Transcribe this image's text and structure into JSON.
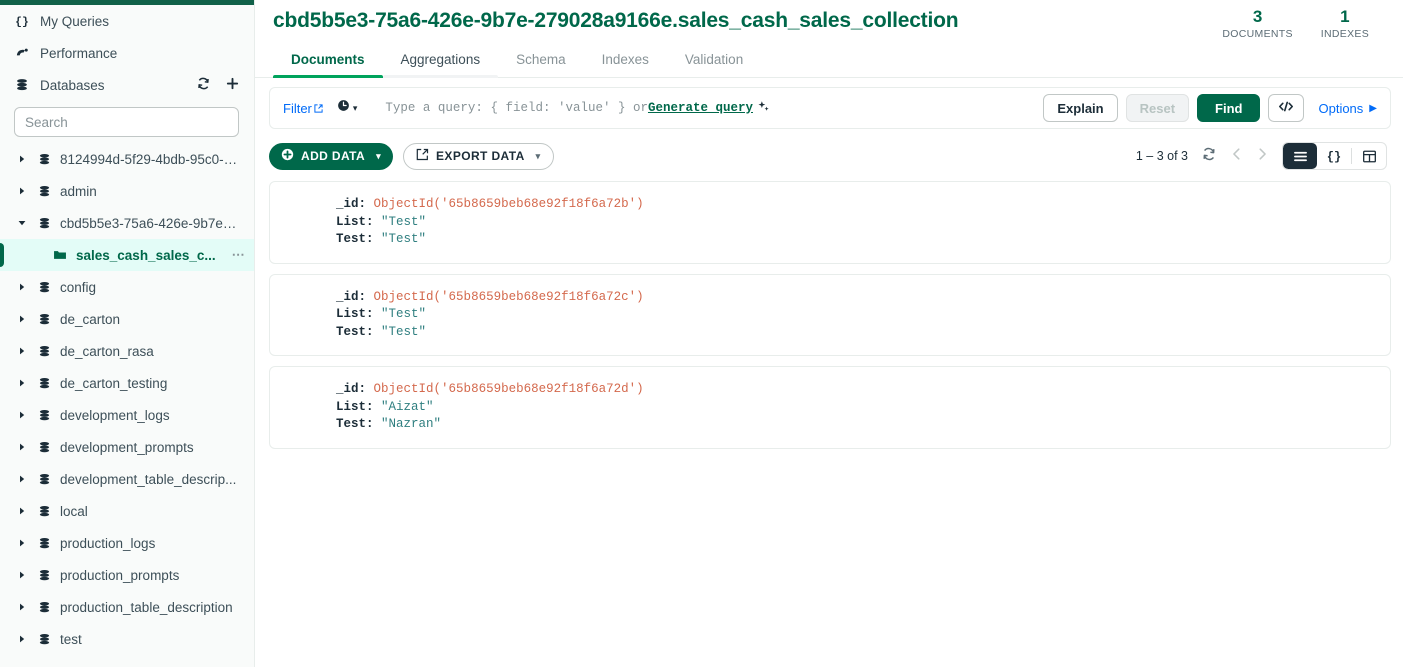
{
  "theme": {
    "brand_green": "#00684a",
    "dark_green_bar": "#116149",
    "accent_blue": "#016bf8",
    "selected_bg": "#e3fcf7",
    "string_value_color": "#307f80",
    "objectid_color": "#d4694d"
  },
  "sidebar": {
    "nav": [
      {
        "label": "My Queries",
        "icon": "braces-icon"
      },
      {
        "label": "Performance",
        "icon": "performance-icon"
      },
      {
        "label": "Databases",
        "icon": "database-icon"
      }
    ],
    "db_actions": [
      {
        "name": "refresh-databases-button",
        "icon": "refresh-icon"
      },
      {
        "name": "create-database-button",
        "icon": "plus-icon"
      }
    ],
    "search": {
      "placeholder": "Search",
      "value": ""
    },
    "tree": [
      {
        "label": "8124994d-5f29-4bdb-95c0-9...",
        "type": "database",
        "expanded": false
      },
      {
        "label": "admin",
        "type": "database",
        "expanded": false
      },
      {
        "label": "cbd5b5e3-75a6-426e-9b7e-...",
        "type": "database",
        "expanded": true
      },
      {
        "label": "sales_cash_sales_c...",
        "type": "collection",
        "selected": true,
        "menu": "⋯"
      },
      {
        "label": "config",
        "type": "database",
        "expanded": false
      },
      {
        "label": "de_carton",
        "type": "database",
        "expanded": false
      },
      {
        "label": "de_carton_rasa",
        "type": "database",
        "expanded": false
      },
      {
        "label": "de_carton_testing",
        "type": "database",
        "expanded": false
      },
      {
        "label": "development_logs",
        "type": "database",
        "expanded": false
      },
      {
        "label": "development_prompts",
        "type": "database",
        "expanded": false
      },
      {
        "label": "development_table_descrip...",
        "type": "database",
        "expanded": false
      },
      {
        "label": "local",
        "type": "database",
        "expanded": false
      },
      {
        "label": "production_logs",
        "type": "database",
        "expanded": false
      },
      {
        "label": "production_prompts",
        "type": "database",
        "expanded": false
      },
      {
        "label": "production_table_description",
        "type": "database",
        "expanded": false
      },
      {
        "label": "test",
        "type": "database",
        "expanded": false
      }
    ]
  },
  "header": {
    "title": "cbd5b5e3-75a6-426e-9b7e-279028a9166e.sales_cash_sales_collection",
    "stats": [
      {
        "value": "3",
        "label": "DOCUMENTS"
      },
      {
        "value": "1",
        "label": "INDEXES"
      }
    ]
  },
  "tabs": [
    {
      "label": "Documents",
      "state": "active"
    },
    {
      "label": "Aggregations",
      "state": "hovered"
    },
    {
      "label": "Schema",
      "state": "normal"
    },
    {
      "label": "Indexes",
      "state": "normal"
    },
    {
      "label": "Validation",
      "state": "normal"
    }
  ],
  "querybar": {
    "filter_label": "Filter",
    "filter_icon": "external-link-icon",
    "history_icon": "clock-icon",
    "history_caret": "▾",
    "placeholder_prefix": "Type a query: { field: 'value' } or ",
    "generate_query_label": "Generate query",
    "sparkle_icon": "sparkle-icon",
    "buttons": {
      "explain": "Explain",
      "reset": "Reset",
      "find": "Find",
      "export_to_language_icon": "code-brackets-icon",
      "options": "Options",
      "options_caret": "▶"
    }
  },
  "toolbar": {
    "add_data": "ADD DATA",
    "add_data_icon": "plus-circle-icon",
    "add_data_caret": "▾",
    "export_data": "EXPORT DATA",
    "export_data_icon": "export-icon",
    "export_data_caret": "▾",
    "count": "1 – 3 of 3",
    "refresh_icon": "refresh-icon",
    "prev_icon": "chevron-left-icon",
    "next_icon": "chevron-right-icon",
    "views": [
      {
        "name": "list-view",
        "icon": "list-icon",
        "selected": true
      },
      {
        "name": "json-view",
        "icon": "braces-icon",
        "selected": false
      },
      {
        "name": "table-view",
        "icon": "table-icon",
        "selected": false
      }
    ]
  },
  "documents": [
    {
      "fields": [
        {
          "key": "_id",
          "value": "ObjectId('65b8659beb68e92f18f6a72b')",
          "type": "objectid"
        },
        {
          "key": "List",
          "value": "\"Test\"",
          "type": "string"
        },
        {
          "key": "Test",
          "value": "\"Test\"",
          "type": "string"
        }
      ]
    },
    {
      "fields": [
        {
          "key": "_id",
          "value": "ObjectId('65b8659beb68e92f18f6a72c')",
          "type": "objectid"
        },
        {
          "key": "List",
          "value": "\"Test\"",
          "type": "string"
        },
        {
          "key": "Test",
          "value": "\"Test\"",
          "type": "string"
        }
      ]
    },
    {
      "fields": [
        {
          "key": "_id",
          "value": "ObjectId('65b8659beb68e92f18f6a72d')",
          "type": "objectid"
        },
        {
          "key": "List",
          "value": "\"Aizat\"",
          "type": "string"
        },
        {
          "key": "Test",
          "value": "\"Nazran\"",
          "type": "string"
        }
      ]
    }
  ]
}
